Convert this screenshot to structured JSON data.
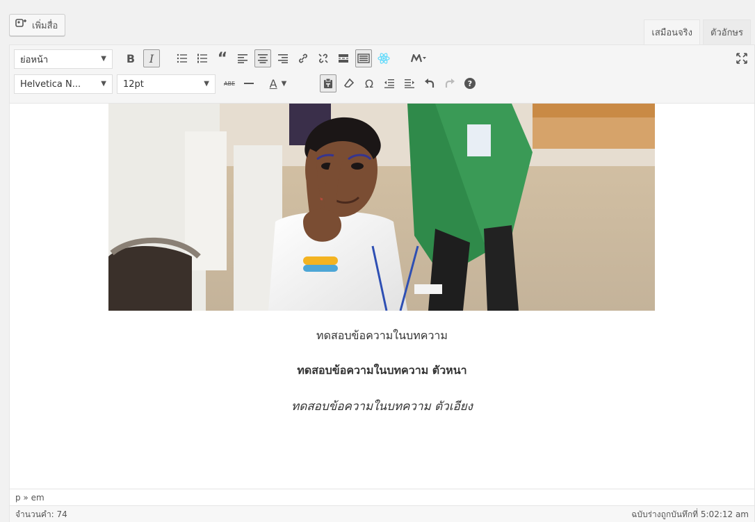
{
  "media_button": {
    "label": "เพิ่มสื่อ",
    "icon": "add-media-icon"
  },
  "tabs": [
    {
      "label": "เสมือนจริง",
      "active": true
    },
    {
      "label": "ตัวอักษร",
      "active": false
    }
  ],
  "toolbar": {
    "format_select": "ย่อหน้า",
    "font_select": "Helvetica N...",
    "size_select": "12pt",
    "buttons_row1": [
      "bold",
      "italic",
      "bulleted-list",
      "numbered-list",
      "blockquote",
      "align-left",
      "align-center",
      "align-right",
      "insert-link",
      "remove-link",
      "insert-read-more",
      "toolbar-toggle",
      "react-plugin",
      "plugin-menu"
    ],
    "buttons_row2": [
      "strikethrough",
      "horizontal-line",
      "text-color",
      "paste-as-text",
      "clear-formatting",
      "special-character",
      "outdent",
      "indent",
      "undo",
      "redo",
      "help"
    ],
    "labels": {
      "bold": "B",
      "italic": "I",
      "blockquote": "“",
      "strikethrough": "ABE",
      "text_color": "A",
      "special_character": "Ω",
      "help": "?"
    }
  },
  "content": {
    "line1": "ทดสอบข้อความในบทความ",
    "line2": "ทดสอบข้อความในบทความ ตัวหนา",
    "line3": "ทดสอบข้อความในบทความ ตัวเอียง"
  },
  "statusbar": {
    "path": "p » em"
  },
  "footer": {
    "word_count": "จำนวนคำ: 74",
    "draft_saved": "ฉบับร่างถูกบันทึกที่ 5:02:12 am"
  },
  "colors": {
    "accent": "#0073aa",
    "toolbar_bg": "#f5f5f5",
    "page_bg": "#f1f1f1",
    "text": "#23282d"
  }
}
